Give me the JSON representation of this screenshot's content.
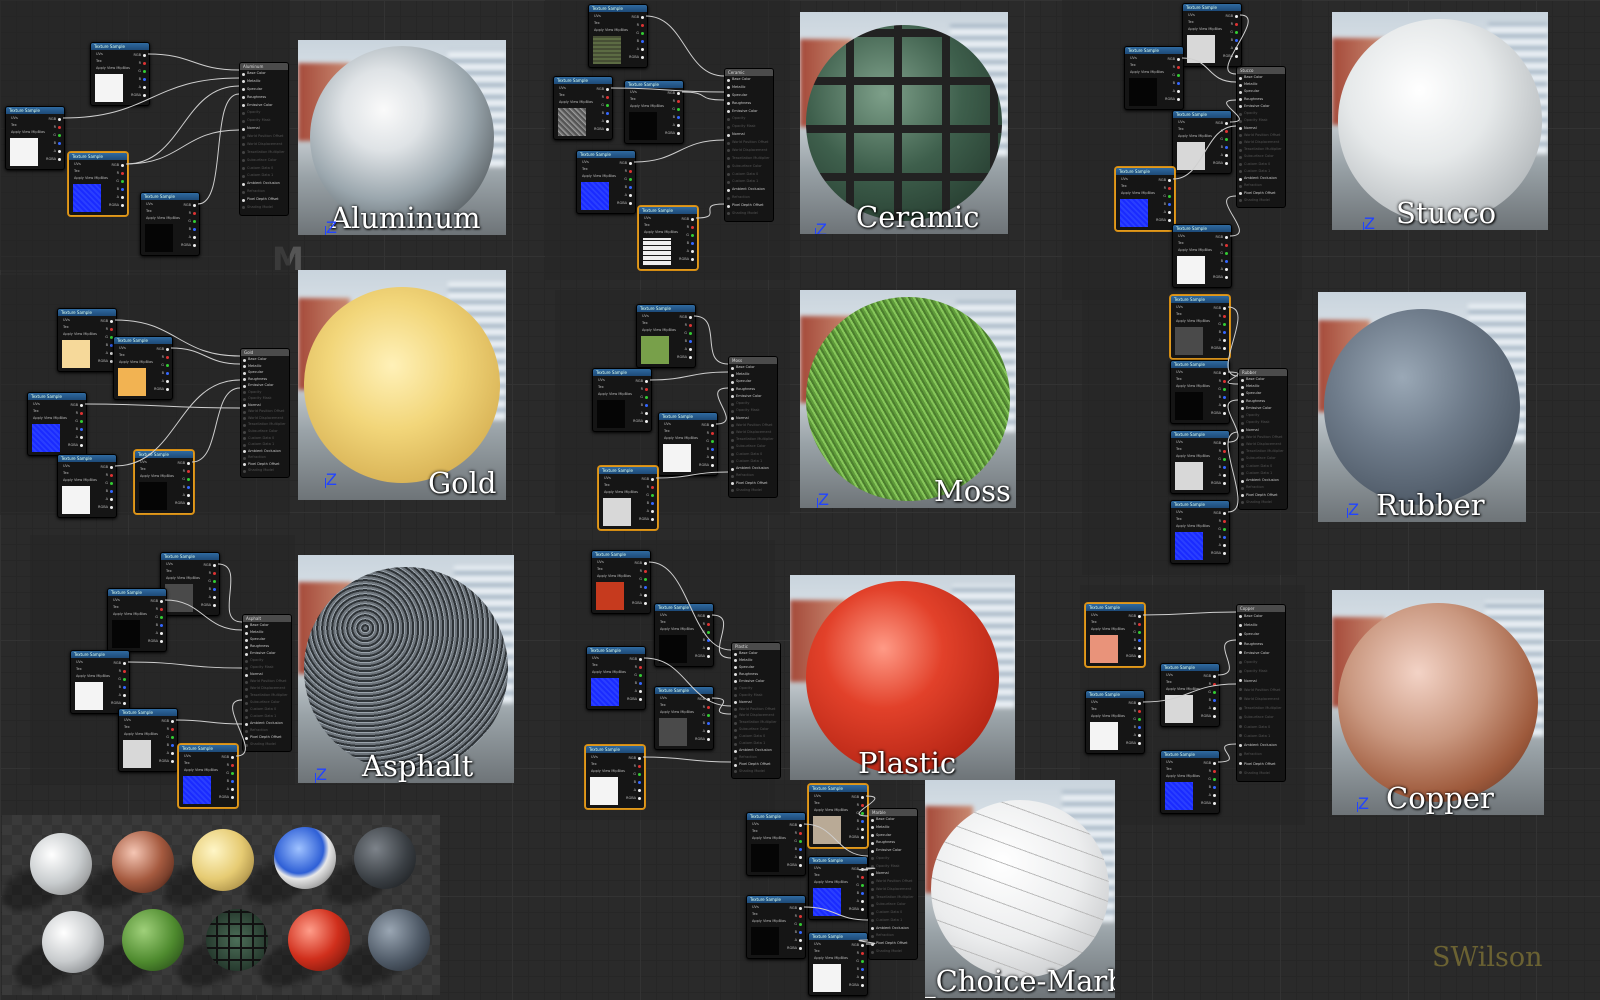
{
  "materials": [
    {
      "key": "aluminum",
      "label": "Aluminum",
      "node_title": "Aluminum"
    },
    {
      "key": "ceramic",
      "label": "Ceramic",
      "node_title": "Ceramic"
    },
    {
      "key": "stucco",
      "label": "Stucco",
      "node_title": "Stucco"
    },
    {
      "key": "gold",
      "label": "Gold",
      "node_title": "Gold"
    },
    {
      "key": "moss",
      "label": "Moss",
      "node_title": "Moss"
    },
    {
      "key": "rubber",
      "label": "Rubber",
      "node_title": "Rubber"
    },
    {
      "key": "asphalt",
      "label": "Asphalt",
      "node_title": "Asphalt"
    },
    {
      "key": "plastic",
      "label": "Plastic",
      "node_title": "Plastic"
    },
    {
      "key": "copper",
      "label": "Copper",
      "node_title": "Copper"
    },
    {
      "key": "marble",
      "label": "My_Choice-Marble",
      "node_title": "Marble"
    }
  ],
  "texture_node": {
    "title": "Texture Sample",
    "inputs": [
      "UVs",
      "Tex",
      "Apply View MipBias"
    ],
    "outputs": [
      "RGB",
      "R",
      "G",
      "B",
      "A",
      "RGBA"
    ]
  },
  "material_node_pins": [
    "Base Color",
    "Metallic",
    "Specular",
    "Roughness",
    "Emissive Color",
    "Opacity",
    "Opacity Mask",
    "Normal",
    "World Position Offset",
    "World Displacement",
    "Tessellation Multiplier",
    "Subsurface Color",
    "Custom Data 0",
    "Custom Data 1",
    "Ambient Occlusion",
    "Refraction",
    "Pixel Depth Offset",
    "Shading Model"
  ],
  "axis_letter": "Z",
  "big_letter": "M",
  "watermark": "SWilson",
  "colors": {
    "canvas": "#2a2a2a",
    "selected_border": "#e09a20",
    "node_header": "#2f6aa0",
    "pin_red": "#d33",
    "pin_green": "#3c3",
    "pin_blue": "#36f",
    "pin_white": "#eee",
    "label": "#ffffff",
    "watermark": "#6b6232"
  }
}
